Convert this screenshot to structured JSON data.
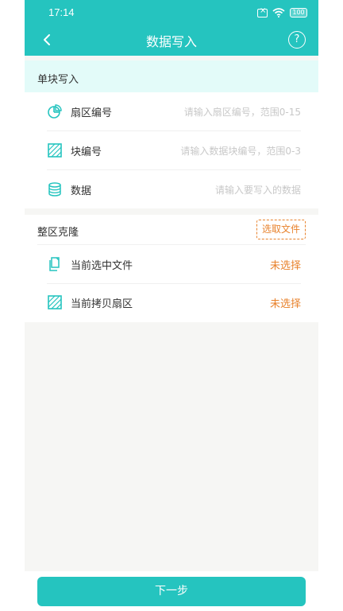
{
  "status": {
    "time": "17:14",
    "battery": "100"
  },
  "navbar": {
    "title": "数据写入",
    "help_label": "?"
  },
  "single_block": {
    "section_title": "单块写入",
    "rows": [
      {
        "label": "扇区编号",
        "placeholder": "请输入扇区编号，范围0-15",
        "icon": "pie-chart-icon"
      },
      {
        "label": "块编号",
        "placeholder": "请输入数据块编号，范围0-3",
        "icon": "hatched-square-icon"
      },
      {
        "label": "数据",
        "placeholder": "请输入要写入的数据",
        "icon": "database-icon"
      }
    ]
  },
  "clone": {
    "section_title": "整区克隆",
    "select_file_label": "选取文件",
    "rows": [
      {
        "label": "当前选中文件",
        "value": "未选择",
        "icon": "file-copy-icon"
      },
      {
        "label": "当前拷贝扇区",
        "value": "未选择",
        "icon": "hatched-square-icon"
      }
    ]
  },
  "footer": {
    "next_label": "下一步"
  },
  "colors": {
    "accent": "#25c4bf",
    "warning": "#e8822c",
    "section_bg": "#e3fbf9"
  }
}
